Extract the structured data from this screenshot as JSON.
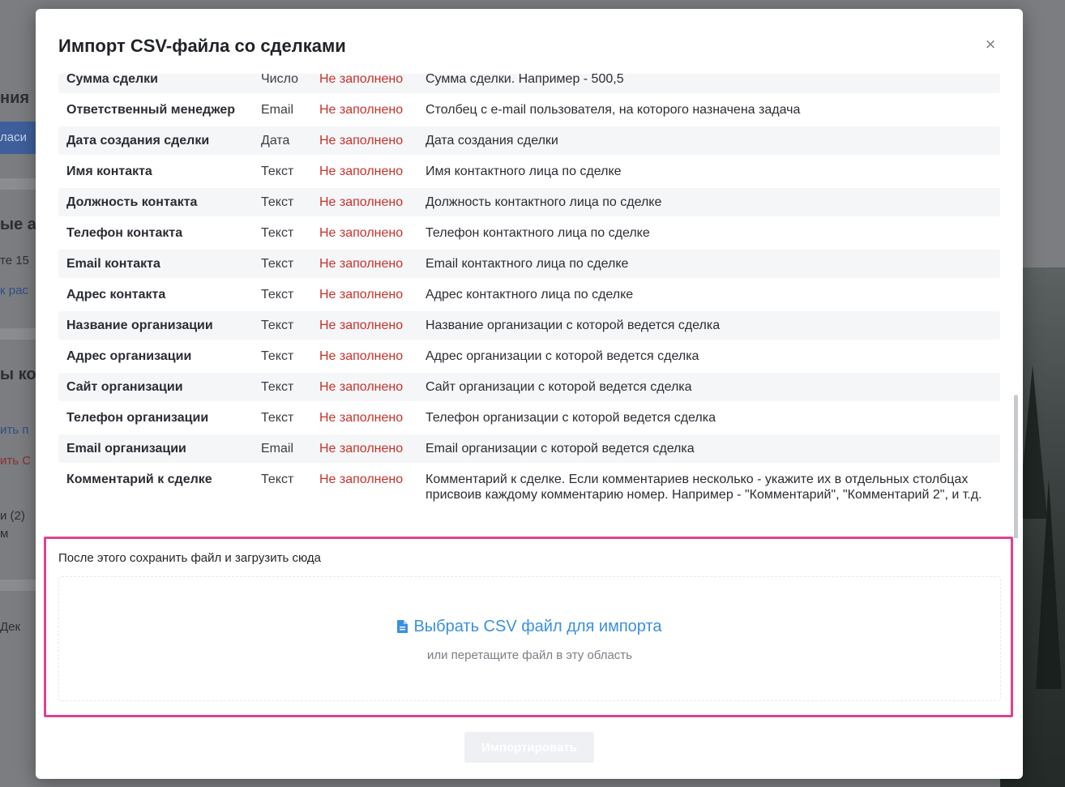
{
  "background": {
    "fragments": [
      "ния",
      "ласи",
      "ые а",
      "те 15",
      "к рас",
      "ы ко",
      "ить п",
      "ить С",
      "и (2)",
      "м",
      "Дек"
    ]
  },
  "modal": {
    "title": "Импорт CSV-файла со сделками",
    "close_label": "×",
    "fields": [
      {
        "name": "Сумма сделки",
        "type": "Число",
        "status": "Не заполнено",
        "description": "Сумма сделки. Например - 500,5"
      },
      {
        "name": "Ответственный менеджер",
        "type": "Email",
        "status": "Не заполнено",
        "description": "Столбец с e-mail пользователя, на которого назначена задача"
      },
      {
        "name": "Дата создания сделки",
        "type": "Дата",
        "status": "Не заполнено",
        "description": "Дата создания сделки"
      },
      {
        "name": "Имя контакта",
        "type": "Текст",
        "status": "Не заполнено",
        "description": "Имя контактного лица по сделке"
      },
      {
        "name": "Должность контакта",
        "type": "Текст",
        "status": "Не заполнено",
        "description": "Должность контактного лица по сделке"
      },
      {
        "name": "Телефон контакта",
        "type": "Текст",
        "status": "Не заполнено",
        "description": "Телефон контактного лица по сделке"
      },
      {
        "name": "Email контакта",
        "type": "Текст",
        "status": "Не заполнено",
        "description": "Email контактного лица по сделке"
      },
      {
        "name": "Адрес контакта",
        "type": "Текст",
        "status": "Не заполнено",
        "description": "Адрес контактного лица по сделке"
      },
      {
        "name": "Название организации",
        "type": "Текст",
        "status": "Не заполнено",
        "description": "Название организации с которой ведется сделка"
      },
      {
        "name": "Адрес организации",
        "type": "Текст",
        "status": "Не заполнено",
        "description": "Адрес организации с которой ведется сделка"
      },
      {
        "name": "Сайт организации",
        "type": "Текст",
        "status": "Не заполнено",
        "description": "Сайт организации с которой ведется сделка"
      },
      {
        "name": "Телефон организации",
        "type": "Текст",
        "status": "Не заполнено",
        "description": "Телефон организации с которой ведется сделка"
      },
      {
        "name": "Email организации",
        "type": "Email",
        "status": "Не заполнено",
        "description": "Email организации с которой ведется сделка"
      },
      {
        "name": "Комментарий к сделке",
        "type": "Текст",
        "status": "Не заполнено",
        "description": "Комментарий к сделке. Если комментариев несколько - укажите их в отдельных столбцах присвоив каждому комментарию номер. Например - \"Комментарий\", \"Комментарий 2\", и т.д."
      }
    ],
    "upload": {
      "caption": "После этого сохранить файл и загрузить сюда",
      "pick_label": "Выбрать CSV файл для импорта",
      "pick_icon": "file-icon",
      "drop_hint": "или перетащите файл в эту область"
    },
    "import_button": "Импортировать"
  },
  "colors": {
    "status_red": "#c7322b",
    "link_blue": "#3b8fe0",
    "highlight_pink": "#e0418f"
  }
}
